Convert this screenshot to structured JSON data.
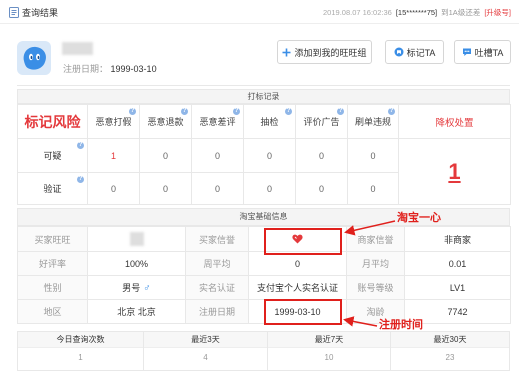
{
  "topbar": {
    "title": "查询结果",
    "time": "2019.08.07 16:02:36",
    "account": "[15*******75]",
    "upgrade_text": "到1A级还差",
    "upgrade_link": "[升级号]"
  },
  "profile": {
    "reg_label": "注册日期：",
    "reg_date": "1999-03-10"
  },
  "actions": {
    "add_label": "添加到我的旺旺组",
    "mark_label": "标记TA",
    "complain_label": "吐槽TA"
  },
  "marks": {
    "section_title": "打标记录",
    "risk_title": "标记风险",
    "columns": [
      "恶意打假",
      "恶意退款",
      "恶意差评",
      "抽检",
      "评价广告",
      "刷单违规"
    ],
    "penalty_title": "降权处置",
    "rows": [
      {
        "label": "可疑",
        "values": [
          "1",
          "0",
          "0",
          "0",
          "0",
          "0"
        ]
      },
      {
        "label": "验证",
        "values": [
          "0",
          "0",
          "0",
          "0",
          "0",
          "0"
        ]
      }
    ],
    "penalty_value": "1"
  },
  "basic": {
    "section_title": "淘宝基础信息",
    "rows": [
      [
        {
          "label": "买家旺旺"
        },
        {
          "label": "买家信誉"
        },
        {
          "label": "商家信誉",
          "value": "非商家"
        }
      ],
      [
        {
          "label": "好评率",
          "value": "100%"
        },
        {
          "label": "周平均",
          "value": "0"
        },
        {
          "label": "月平均",
          "value": "0.01"
        }
      ],
      [
        {
          "label": "性别",
          "value": "男号"
        },
        {
          "label": "实名认证",
          "value": "支付宝个人实名认证"
        },
        {
          "label": "账号等级",
          "value": "LV1"
        }
      ],
      [
        {
          "label": "地区",
          "value": "北京 北京"
        },
        {
          "label": "注册日期",
          "value": "1999-03-10"
        },
        {
          "label": "淘龄",
          "value": "7742"
        }
      ]
    ]
  },
  "annotations": {
    "credit_note": "淘宝一心",
    "reg_note": "注册时间"
  },
  "stats": {
    "headers": [
      "今日查询次数",
      "最近3天",
      "最近7天",
      "最近30天"
    ],
    "values": [
      "1",
      "4",
      "10",
      "23"
    ]
  },
  "icons": {
    "result": "document-icon",
    "avatar": "wangwang-avatar",
    "add": "plus-icon",
    "mark": "tag-icon",
    "complain": "comment-icon",
    "help": "help-icon",
    "credit": "heart-icon",
    "gender": "male-icon"
  },
  "colors": {
    "accent": "#3a8ee6",
    "risk_red": "#e4393c",
    "annotation_red": "#e0201c"
  }
}
